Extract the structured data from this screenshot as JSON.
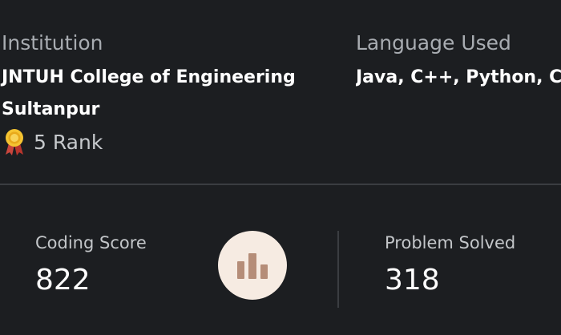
{
  "institution": {
    "label": "Institution",
    "name_line1": "JNTUH College of Engineering",
    "name_line2": "Sultanpur",
    "rank": "5 Rank"
  },
  "language": {
    "label": "Language Used",
    "value": "Java, C++, Python, C"
  },
  "stats": {
    "coding_score_label": "Coding Score",
    "coding_score_value": "822",
    "problems_solved_label": "Problem Solved",
    "problems_solved_value": "318"
  },
  "icons": {
    "rank": "medal-icon",
    "score": "bar-chart-icon"
  },
  "colors": {
    "background": "#1c1e21",
    "muted_text": "#a8acb1",
    "divider": "#3a3d41",
    "chart_circle": "#f6ebe2",
    "chart_bars": "#b58d78"
  }
}
